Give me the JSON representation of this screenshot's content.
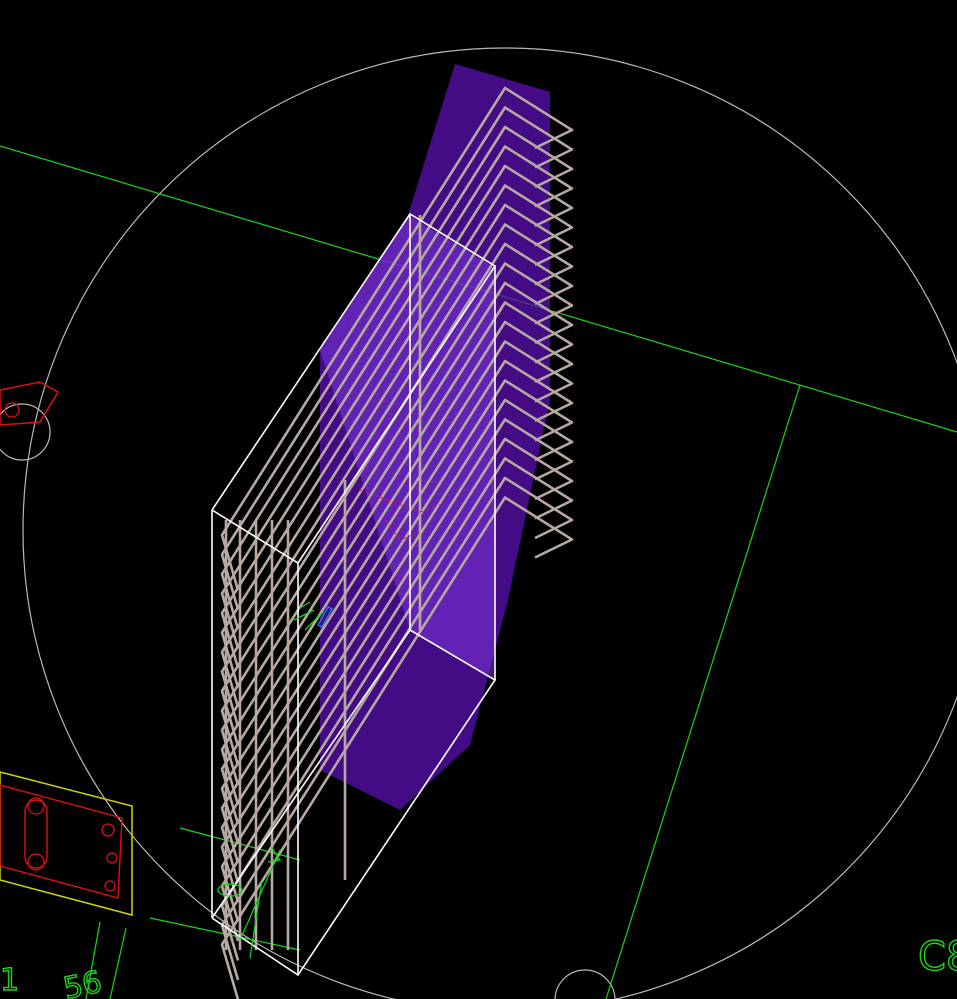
{
  "viewport": {
    "background": "#000000",
    "colors": {
      "grid_lines": "#17d617",
      "rebar": "#b7a9a2",
      "solid_wireframe": "#ffffff",
      "selection_highlight": "#7a2bd8",
      "view_circle": "#b9b9b9",
      "detail_outline": "#d4d400",
      "detail_red": "#e01010"
    }
  },
  "grid_labels": {
    "right_bottom": "C8",
    "bottom_left_a": "56",
    "bottom_left_b": "1"
  },
  "icons": {
    "ucs": "ucs-axis-icon",
    "grip": "grip-icon"
  }
}
